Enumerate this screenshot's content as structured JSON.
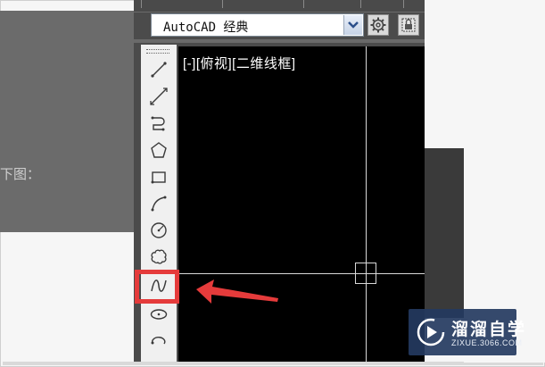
{
  "page": {
    "visible_text": "下图："
  },
  "workspace": {
    "selected": "AutoCAD 经典"
  },
  "toolbar": {
    "icons": [
      "gear-icon",
      "lock-icon"
    ]
  },
  "draw_palette": {
    "tools": [
      "line-icon",
      "construction-line-icon",
      "polyline-icon",
      "polygon-icon",
      "rectangle-icon",
      "arc-icon",
      "circle-icon",
      "revision-cloud-icon",
      "spline-icon",
      "ellipse-icon",
      "ellipse-arc-icon"
    ],
    "highlighted_tool": "spline-icon",
    "highlight_color": "#e53b3b"
  },
  "viewport": {
    "label": "[-][俯视][二维线框]",
    "background": "#000000"
  },
  "annotation": {
    "arrow_color": "#e53b3b"
  },
  "watermark": {
    "name": "溜溜自学",
    "url": "ZIXUE.3066.COM"
  }
}
